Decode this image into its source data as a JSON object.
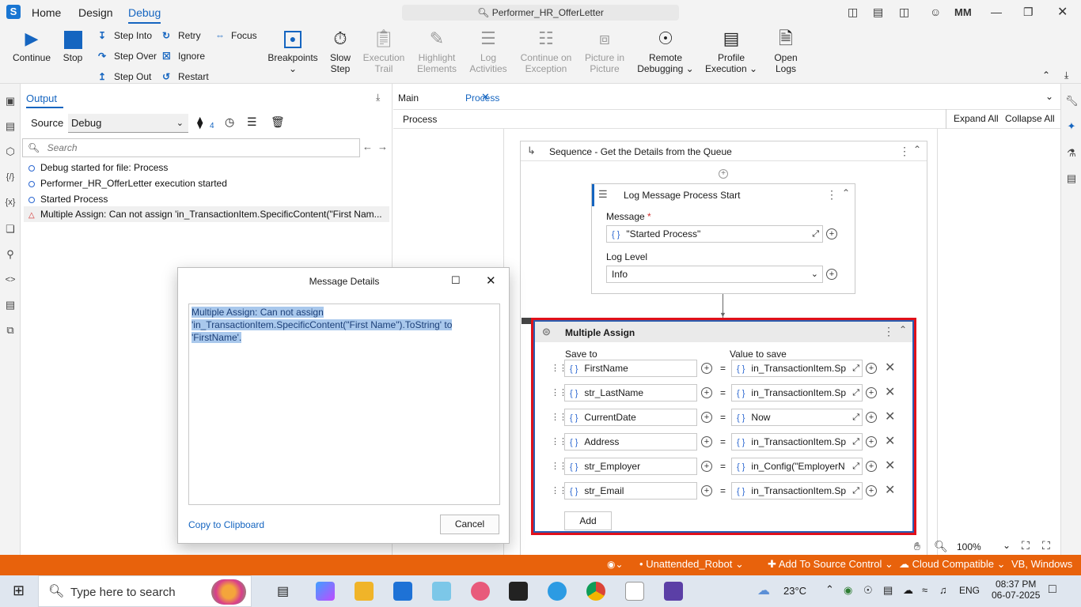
{
  "titlebar": {
    "tabs": [
      "Home",
      "Design",
      "Debug"
    ],
    "search_text": "Performer_HR_OfferLetter",
    "user_initials": "MM"
  },
  "ribbon": {
    "continue": "Continue",
    "stop": "Stop",
    "step_into": "Step Into",
    "step_over": "Step Over",
    "step_out": "Step Out",
    "retry": "Retry",
    "ignore": "Ignore",
    "restart": "Restart",
    "focus": "Focus",
    "breakpoints": "Breakpoints",
    "slow_step_1": "Slow",
    "slow_step_2": "Step",
    "exec_trail_1": "Execution",
    "exec_trail_2": "Trail",
    "highlight_1": "Highlight",
    "highlight_2": "Elements",
    "log_act_1": "Log",
    "log_act_2": "Activities",
    "continue_exc_1": "Continue on",
    "continue_exc_2": "Exception",
    "pip_1": "Picture in",
    "pip_2": "Picture",
    "remote_1": "Remote",
    "remote_2": "Debugging",
    "profile_1": "Profile",
    "profile_2": "Execution",
    "open_logs_1": "Open",
    "open_logs_2": "Logs"
  },
  "output": {
    "tab_label": "Output",
    "source_label": "Source",
    "source_value": "Debug",
    "filter_count": "4",
    "search_placeholder": "Search",
    "lines": [
      "Debug started for file: Process",
      "Performer_HR_OfferLetter execution started",
      "Started Process",
      "Multiple Assign: Can not assign 'in_TransactionItem.SpecificContent(\"First Nam..."
    ]
  },
  "designer": {
    "tabs": [
      "Main",
      "Process"
    ],
    "breadcrumb": "Process",
    "expand_all": "Expand All",
    "collapse_all": "Collapse All",
    "sequence_title": "Sequence - Get the Details from the Queue",
    "log_message": {
      "title": "Log Message Process Start",
      "message_label": "Message",
      "message_value": "\"Started Process\"",
      "level_label": "Log Level",
      "level_value": "Info"
    },
    "multiple_assign": {
      "title": "Multiple Assign",
      "save_to_header": "Save to",
      "value_header": "Value to save",
      "rows": [
        {
          "to": "FirstName",
          "value": "in_TransactionItem.Sp"
        },
        {
          "to": "str_LastName",
          "value": "in_TransactionItem.Sp"
        },
        {
          "to": "CurrentDate",
          "value": "Now"
        },
        {
          "to": "Address",
          "value": "in_TransactionItem.Sp"
        },
        {
          "to": "str_Employer",
          "value": "in_Config(\"EmployerN"
        },
        {
          "to": "str_Email",
          "value": "in_TransactionItem.Sp"
        }
      ],
      "add_label": "Add",
      "equals": "="
    },
    "zoom": "100%"
  },
  "dialog": {
    "title": "Message Details",
    "message": "Multiple Assign: Can not assign 'in_TransactionItem.SpecificContent(\"First Name\").ToString' to 'FirstName'.",
    "copy_label": "Copy to Clipboard",
    "cancel_label": "Cancel"
  },
  "statusbar": {
    "robot": "Unattended_Robot",
    "source_control": "Add To Source Control",
    "compat": "Cloud Compatible",
    "lang": "VB, Windows"
  },
  "taskbar": {
    "search_placeholder": "Type here to search",
    "temperature": "23°C",
    "language": "ENG",
    "time": "08:37 PM",
    "date": "06-07-2025"
  },
  "colors": {
    "accent": "#1565c0",
    "status_orange": "#e8620c",
    "selection_red": "#e0101a",
    "selection_blue": "#2a5db0"
  }
}
